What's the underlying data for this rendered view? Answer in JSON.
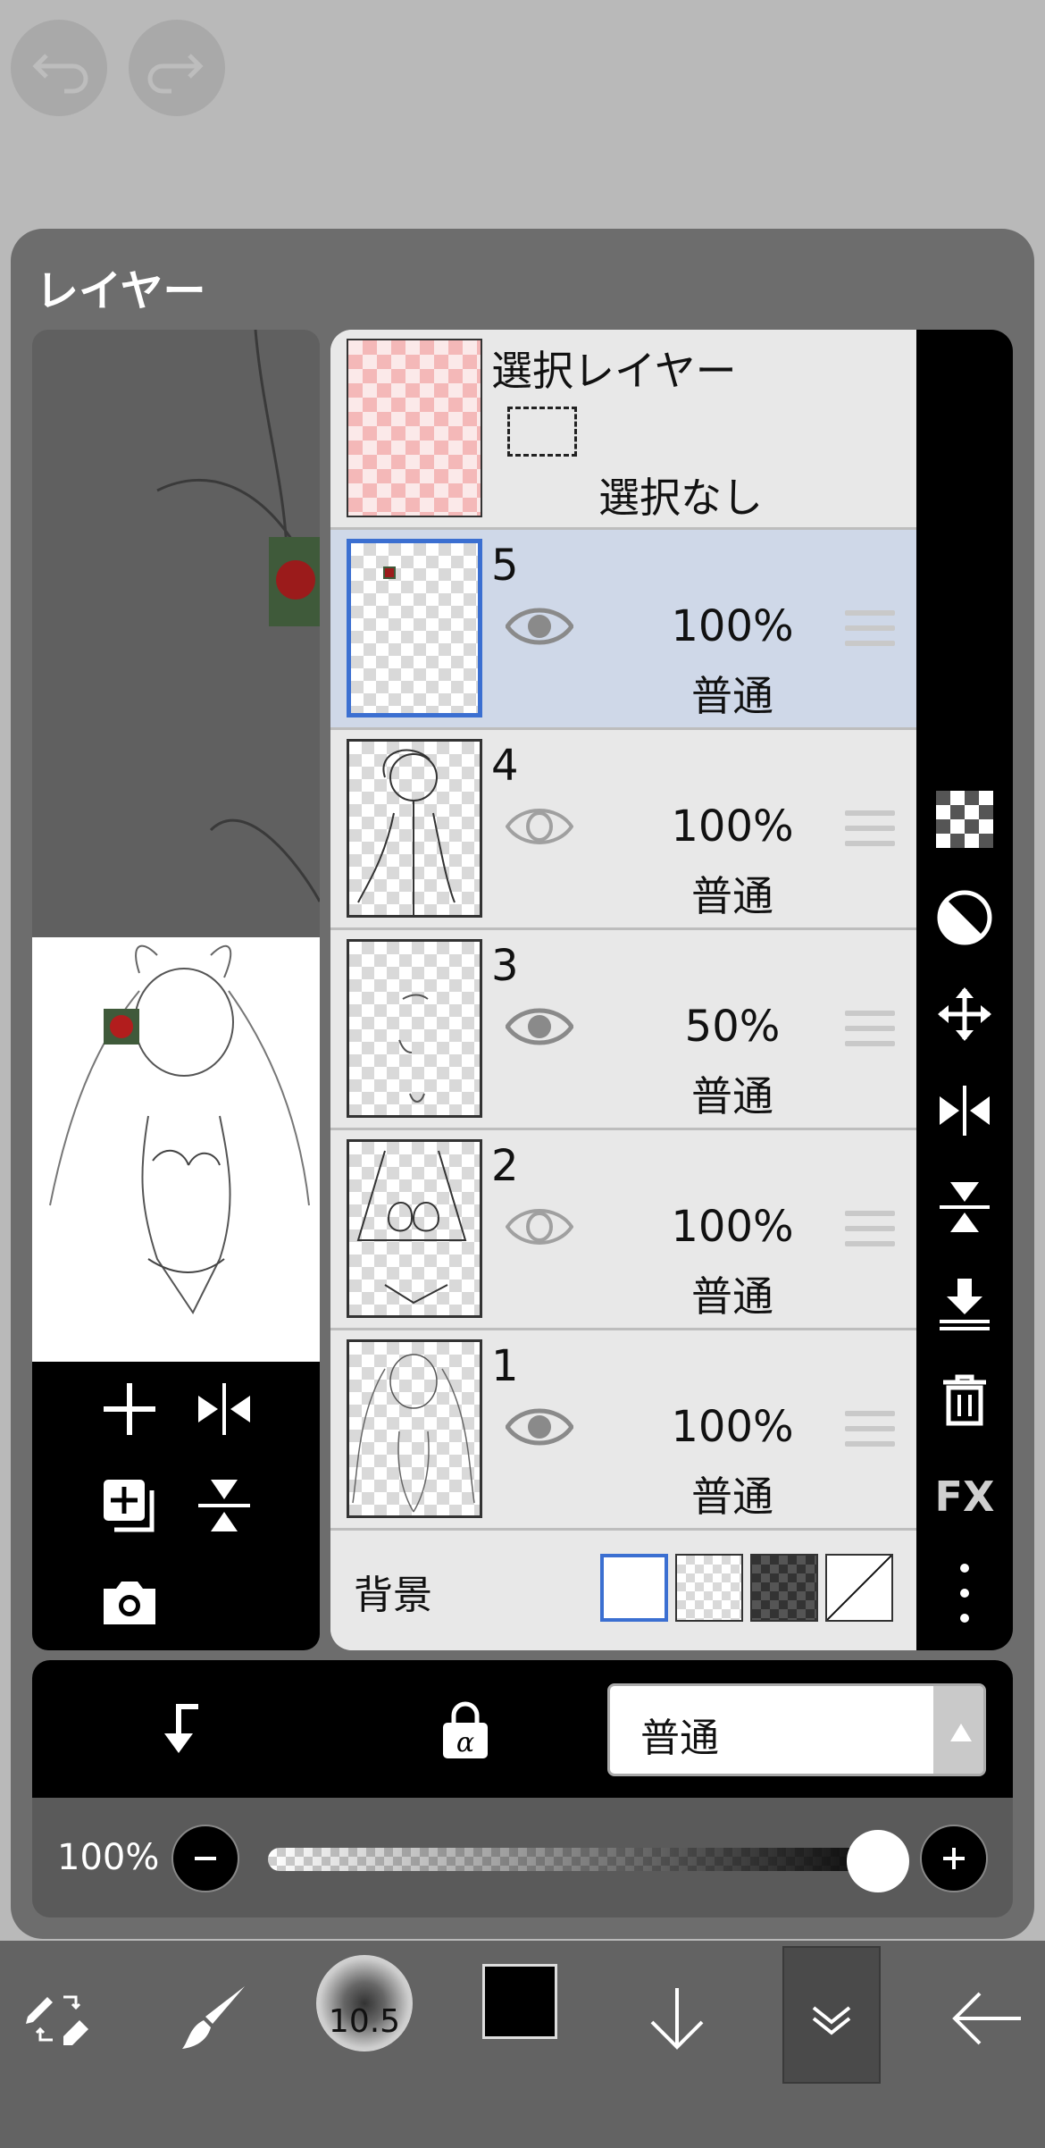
{
  "panel": {
    "title": "レイヤー"
  },
  "selection_layer": {
    "title": "選択レイヤー",
    "status": "選択なし"
  },
  "layers": [
    {
      "number": "5",
      "opacity": "100%",
      "mode": "普通",
      "visible": true,
      "selected": true
    },
    {
      "number": "4",
      "opacity": "100%",
      "mode": "普通",
      "visible": false,
      "selected": false
    },
    {
      "number": "3",
      "opacity": "50%",
      "mode": "普通",
      "visible": true,
      "selected": false
    },
    {
      "number": "2",
      "opacity": "100%",
      "mode": "普通",
      "visible": false,
      "selected": false
    },
    {
      "number": "1",
      "opacity": "100%",
      "mode": "普通",
      "visible": true,
      "selected": false
    }
  ],
  "background": {
    "label": "背景",
    "options": [
      "white",
      "transparent",
      "dark-checker",
      "none"
    ],
    "selected": "white"
  },
  "right_toolbar": {
    "fx_label": "FX"
  },
  "blend": {
    "mode_label": "普通"
  },
  "opacity_slider": {
    "value_label": "100%",
    "value": 1.0
  },
  "bottom_toolbar": {
    "brush_size": "10.5",
    "current_color": "#000000"
  },
  "colors": {
    "accent": "#3b6fd1",
    "selected_row": "#cfd8e8"
  }
}
